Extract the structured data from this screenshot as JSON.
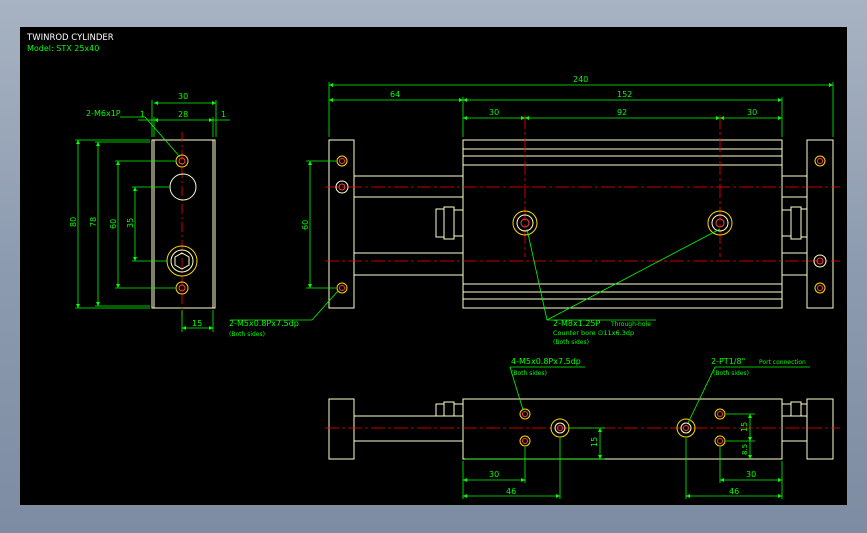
{
  "title_block": {
    "title": "TWINROD CYLINDER",
    "model": "Model: STX 25x40"
  },
  "dimensions": {
    "side_width": "30",
    "side_inner": "28",
    "side_offset": "1",
    "side_height_outer": "80",
    "side_height_mid": "78",
    "side_height_inner": "60",
    "side_port_spacing": "35",
    "side_bottom": "15",
    "front_total": "240",
    "front_left": "64",
    "front_body": "152",
    "front_body_left": "30",
    "front_body_mid": "92",
    "front_body_right": "30",
    "front_height": "60",
    "top_left_30": "30",
    "top_left_46": "46",
    "top_right_30": "30",
    "top_right_46": "46",
    "top_mid_15": "15",
    "top_right_15": "15",
    "top_right_85": "8.5"
  },
  "callouts": {
    "m6": "2-M6x1P",
    "m5_front": "2-M5x0.8Px7.5dp",
    "m5_front_sub": "(Both sides)",
    "m8": "2-M8x1.25P",
    "m8_suffix": "Through-hole",
    "m8_sub": "Counter bore ∅11x6.3dp",
    "m8_sub2": "(Both sides)",
    "m5_top": "4-M5x0.8Px7.5dp",
    "m5_top_sub": "(Both sides)",
    "pt": "2-PT1/8\"",
    "pt_suffix": "Port connection",
    "pt_sub": "(Both sides)"
  },
  "colors": {
    "background": "#000000",
    "outline": "#ffffcc",
    "dimension": "#00ff00",
    "centerline": "#ff0000",
    "label": "#ffffff",
    "thread": "#ffd700"
  }
}
